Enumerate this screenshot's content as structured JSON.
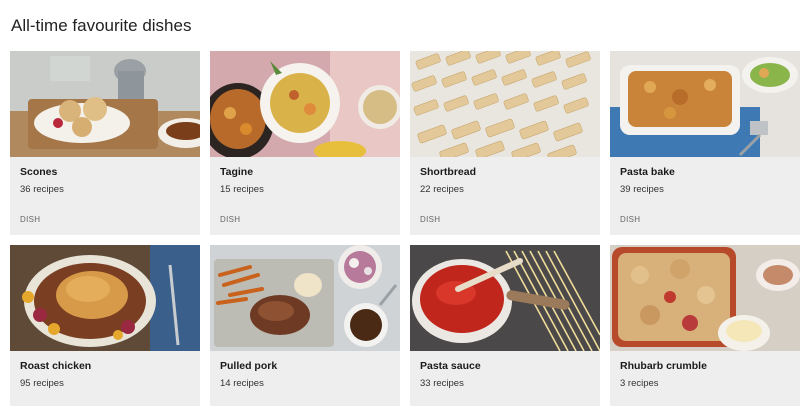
{
  "section": {
    "title": "All-time favourite dishes"
  },
  "cards": [
    {
      "title": "Scones",
      "count": "36 recipes",
      "type": "DISH",
      "image": "scones-photo"
    },
    {
      "title": "Tagine",
      "count": "15 recipes",
      "type": "DISH",
      "image": "tagine-photo"
    },
    {
      "title": "Shortbread",
      "count": "22 recipes",
      "type": "DISH",
      "image": "shortbread-photo"
    },
    {
      "title": "Pasta bake",
      "count": "39 recipes",
      "type": "DISH",
      "image": "pasta-bake-photo"
    },
    {
      "title": "Roast chicken",
      "count": "95 recipes",
      "type": "",
      "image": "roast-chicken-photo"
    },
    {
      "title": "Pulled pork",
      "count": "14 recipes",
      "type": "",
      "image": "pulled-pork-photo"
    },
    {
      "title": "Pasta sauce",
      "count": "33 recipes",
      "type": "",
      "image": "pasta-sauce-photo"
    },
    {
      "title": "Rhubarb crumble",
      "count": "3 recipes",
      "type": "",
      "image": "rhubarb-crumble-photo"
    }
  ],
  "colors": {
    "card_background": "#eeeeee",
    "page_background": "#ffffff"
  }
}
